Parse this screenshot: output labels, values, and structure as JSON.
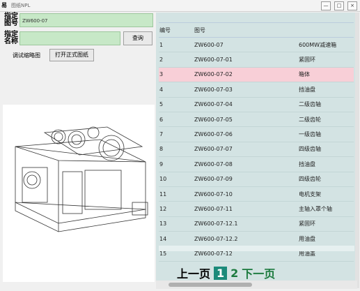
{
  "window": {
    "title": "图纸NPL",
    "app_icon": "易",
    "minimize": "—",
    "restore": "□",
    "close": "×"
  },
  "form": {
    "label_drawing_no": "指定图号",
    "drawing_no_value": "ZW600-07",
    "label_name": "指定名称",
    "name_value": "",
    "search_button": "查询",
    "thumbnail_label": "调试缩略图",
    "open_button": "打开正式图纸"
  },
  "table": {
    "headers": [
      "编号",
      "图号",
      ""
    ],
    "rows": [
      [
        "1",
        "ZW600-07",
        "600MW减速箱"
      ],
      [
        "2",
        "ZW600-07-01",
        "紧固环"
      ],
      [
        "3",
        "ZW600-07-02",
        "箱体"
      ],
      [
        "4",
        "ZW600-07-03",
        "挡油盘"
      ],
      [
        "5",
        "ZW600-07-04",
        "二级齿轴"
      ],
      [
        "6",
        "ZW600-07-05",
        "二级齿轮"
      ],
      [
        "7",
        "ZW600-07-06",
        "一级齿轴"
      ],
      [
        "8",
        "ZW600-07-07",
        "四级齿轴"
      ],
      [
        "9",
        "ZW600-07-08",
        "挡油盘"
      ],
      [
        "10",
        "ZW600-07-09",
        "四级齿轮"
      ],
      [
        "11",
        "ZW600-07-10",
        "电机支架"
      ],
      [
        "12",
        "ZW600-07-11",
        "主轴入罩个轴"
      ],
      [
        "13",
        "ZW600-07-12.1",
        "紧固环"
      ],
      [
        "14",
        "ZW600-07-12.2",
        "用油盘"
      ],
      [
        "15",
        "ZW600-07-12",
        "用油盖"
      ]
    ],
    "selected_row": 2
  },
  "pager": {
    "prev": "上一页",
    "current": "1",
    "next_page": "2",
    "next": "下一页"
  },
  "colors": {
    "input_bg": "#c7e8c7",
    "panel_bg": "#d3e3e3",
    "selected_row": "#f8cfd7",
    "pager_current": "#1b8a7a",
    "pager_link": "#1b7a3e"
  }
}
